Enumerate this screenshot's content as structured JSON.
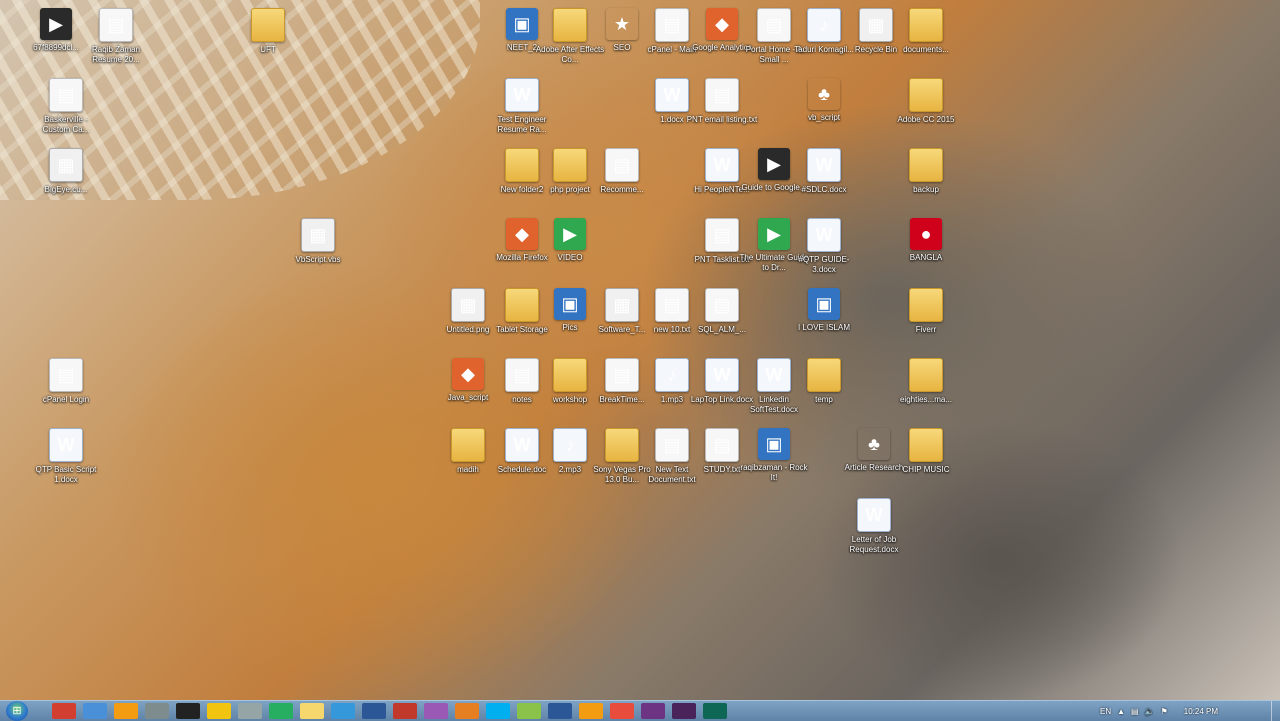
{
  "desktop": {
    "icons": [
      {
        "label": "67f8899dcl...",
        "type": "dark"
      },
      {
        "label": "Raqib Zaman Resume 20...",
        "type": "doc"
      },
      {
        "label": "UFT",
        "type": "folder"
      },
      {
        "label": "NEET_2",
        "type": "app"
      },
      {
        "label": "Adobe After Effects Co...",
        "type": "folder"
      },
      {
        "label": "SEO",
        "type": "star"
      },
      {
        "label": "cPanel - Main",
        "type": "doc"
      },
      {
        "label": "Google Analytics",
        "type": "orange"
      },
      {
        "label": "Portal Home - A Small ...",
        "type": "doc"
      },
      {
        "label": "Taduri Komagil...",
        "type": "mp3"
      },
      {
        "label": "Recycle Bin",
        "type": "img"
      },
      {
        "label": "documents...",
        "type": "folder"
      },
      {
        "label": "Baskerville - Custom Ca...",
        "type": "doc"
      },
      {
        "label": "BigEye.cu...",
        "type": "img"
      },
      {
        "label": "Test Engineer Resume Ra...",
        "type": "word"
      },
      {
        "label": "1.docx",
        "type": "word"
      },
      {
        "label": "PNT email listing.txt",
        "type": "doc"
      },
      {
        "label": "vb_script",
        "type": "tree"
      },
      {
        "label": "Adobe CC 2015",
        "type": "folder"
      },
      {
        "label": "New folder2",
        "type": "folder"
      },
      {
        "label": "php project",
        "type": "folder"
      },
      {
        "label": "Recomme...",
        "type": "doc"
      },
      {
        "label": "Hi PeopleNTe...",
        "type": "word"
      },
      {
        "label": "Guide to Google...",
        "type": "dark"
      },
      {
        "label": "#SDLC.docx",
        "type": "word"
      },
      {
        "label": "backup",
        "type": "folder"
      },
      {
        "label": "VbScript.vbs",
        "type": "img"
      },
      {
        "label": "Mozilla Firefox",
        "type": "orange"
      },
      {
        "label": "VIDEO",
        "type": "green"
      },
      {
        "label": "PNT Tasklist.txt",
        "type": "doc"
      },
      {
        "label": "The Ultimate Guide to Dr...",
        "type": "green"
      },
      {
        "label": "#QTP GUIDE-3.docx",
        "type": "word"
      },
      {
        "label": "BANGLA",
        "type": "red"
      },
      {
        "label": "Untitled.png",
        "type": "img"
      },
      {
        "label": "Tablet Storage",
        "type": "folder"
      },
      {
        "label": "Pics",
        "type": "app"
      },
      {
        "label": "Software_T...",
        "type": "img"
      },
      {
        "label": "new 10.txt",
        "type": "doc"
      },
      {
        "label": "SQL_ALM_...",
        "type": "doc"
      },
      {
        "label": "I LOVE ISLAM",
        "type": "app"
      },
      {
        "label": "Fiverr",
        "type": "folder"
      },
      {
        "label": "cPanel Login",
        "type": "doc"
      },
      {
        "label": "Java_script",
        "type": "orange"
      },
      {
        "label": "notes",
        "type": "doc"
      },
      {
        "label": "workshop",
        "type": "folder"
      },
      {
        "label": "BreakTime...",
        "type": "doc"
      },
      {
        "label": "1.mp3",
        "type": "mp3"
      },
      {
        "label": "LapTop Link.docx",
        "type": "word"
      },
      {
        "label": "Linkedin SoftTest.docx",
        "type": "word"
      },
      {
        "label": "temp",
        "type": "folder"
      },
      {
        "label": "eighties...ma...",
        "type": "folder"
      },
      {
        "label": "QTP Basic Script 1.docx",
        "type": "word"
      },
      {
        "label": "madih",
        "type": "folder"
      },
      {
        "label": "Schedule.doc",
        "type": "word"
      },
      {
        "label": "2.mp3",
        "type": "mp3"
      },
      {
        "label": "Sony Vegas Pro 13.0 Bu...",
        "type": "folder"
      },
      {
        "label": "New Text Document.txt",
        "type": "doc"
      },
      {
        "label": "STUDY.txt",
        "type": "doc"
      },
      {
        "label": "raqibzaman - Rock It!",
        "type": "app"
      },
      {
        "label": "Article Research",
        "type": "tree"
      },
      {
        "label": "CHIP MUSIC",
        "type": "folder"
      },
      {
        "label": "Letter of Job Request.docx",
        "type": "word"
      }
    ]
  },
  "taskbar": {
    "start_icon": "windows-start-icon",
    "apps": [
      "chrome-icon",
      "folder-icon",
      "media-player-icon",
      "calculator-icon",
      "obs-icon",
      "explorer-icon",
      "notepad-icon",
      "excel-icon",
      "sticky-icon",
      "paint-icon",
      "word-icon",
      "acrobat-icon",
      "snipping-icon",
      "illustrator-icon",
      "skype-icon",
      "notepadpp-icon",
      "winword-icon",
      "vlc-icon",
      "java-icon",
      "aftereffects-icon",
      "premiere-icon",
      "terminal-icon"
    ],
    "tray": {
      "language": "EN",
      "clock": "10:24 PM"
    }
  }
}
